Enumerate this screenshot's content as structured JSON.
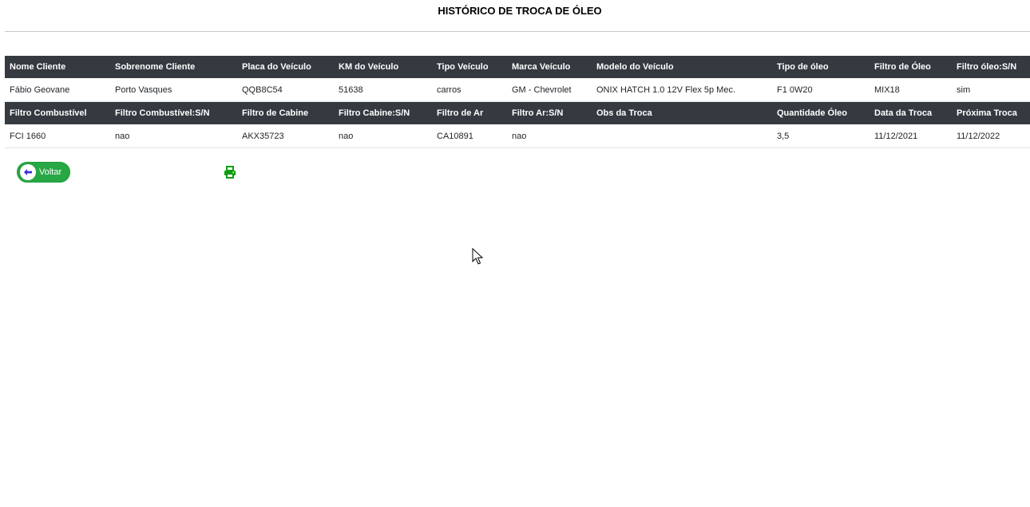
{
  "page": {
    "title": "HISTÓRICO DE TROCA DE ÓLEO"
  },
  "table": {
    "row1_headers": [
      "Nome Cliente",
      "Sobrenome Cliente",
      "Placa do Veículo",
      "KM do Veículo",
      "Tipo Veículo",
      "Marca Veículo",
      "Modelo do Veículo",
      "Tipo de óleo",
      "Filtro de Óleo",
      "Filtro óleo:S/N"
    ],
    "row1_values": [
      "Fábio Geovane",
      "Porto Vasques",
      "QQB8C54",
      "51638",
      "carros",
      "GM - Chevrolet",
      "ONIX HATCH 1.0 12V Flex 5p Mec.",
      "F1 0W20",
      "MIX18",
      "sim"
    ],
    "row2_headers": [
      "Filtro Combustível",
      "Filtro Combustível:S/N",
      "Filtro de Cabine",
      "Filtro Cabine:S/N",
      "Filtro de Ar",
      "Filtro Ar:S/N",
      "Obs da Troca",
      "Quantidade Óleo",
      "Data da Troca",
      "Próxima Troca"
    ],
    "row2_values": [
      "FCI 1660",
      "nao",
      "AKX35723",
      "nao",
      "CA10891",
      "nao",
      "",
      "3,5",
      "11/12/2021",
      "11/12/2022"
    ]
  },
  "actions": {
    "back_label": "Voltar",
    "back_icon": "arrow-left-icon",
    "print_icon": "printer-icon"
  },
  "colors": {
    "header_bg": "#343a40",
    "header_text": "#ffffff",
    "button_green": "#28a745",
    "back_arrow": "#3b2fd6",
    "print_icon": "#0f9d0f"
  }
}
